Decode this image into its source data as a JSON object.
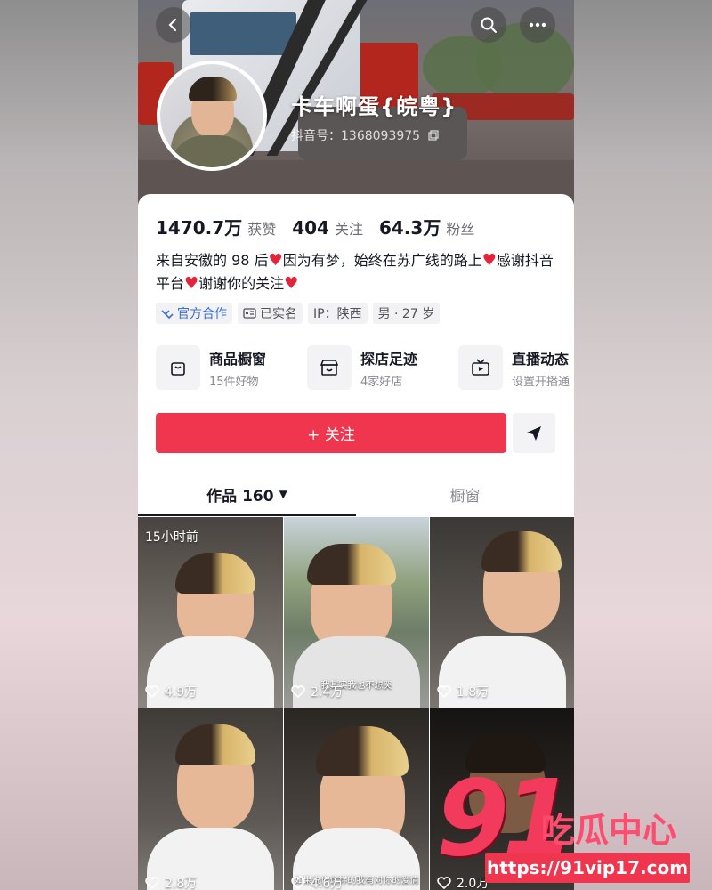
{
  "header": {
    "nickname": "卡车啊蛋{皖粤}",
    "douyin_id": "抖音号：1368093975",
    "back_icon": "chevron-left-icon",
    "search_icon": "search-icon",
    "more_icon": "more-icon"
  },
  "stats": {
    "likes_value": "1470.7万",
    "likes_label": "获赞",
    "following_value": "404",
    "following_label": "关注",
    "followers_value": "64.3万",
    "followers_label": "粉丝"
  },
  "bio": {
    "part1": "来自安徽的 98 后",
    "part2": "因为有梦，始终在苏广线的路上",
    "part3": "感谢抖音平台",
    "part4": "谢谢你的关注"
  },
  "tags": {
    "official": "官方合作",
    "verified": "已实名",
    "ip": "IP：陕西",
    "gender_age": "男 · 27 岁"
  },
  "shortcuts": [
    {
      "title": "商品橱窗",
      "sub": "15件好物"
    },
    {
      "title": "探店足迹",
      "sub": "4家好店"
    },
    {
      "title": "直播动态",
      "sub": "设置开播通"
    }
  ],
  "actions": {
    "follow_label": "+ 关注"
  },
  "tabs": {
    "works_label": "作品 160",
    "works_arrow": "▼",
    "shop_label": "橱窗"
  },
  "videos": [
    {
      "likes": "4.9万",
      "badge": "15小时前",
      "caption": ""
    },
    {
      "likes": "2.4万",
      "badge": "",
      "caption": "我其实我也不想哭"
    },
    {
      "likes": "1.8万",
      "badge": "",
      "caption": ""
    },
    {
      "likes": "2.8万",
      "badge": "",
      "caption": ""
    },
    {
      "likes": "4.6万",
      "badge": "",
      "caption": "如果说你这样的我有对你的爱情"
    },
    {
      "likes": "2.0万",
      "badge": "",
      "caption": ""
    }
  ],
  "watermark": {
    "number": "91",
    "text": "吃瓜中心",
    "url": "https://91vip17.com"
  },
  "colors": {
    "accent": "#f0364f",
    "heart": "#e5243b",
    "official_blue": "#3a6ed8"
  }
}
